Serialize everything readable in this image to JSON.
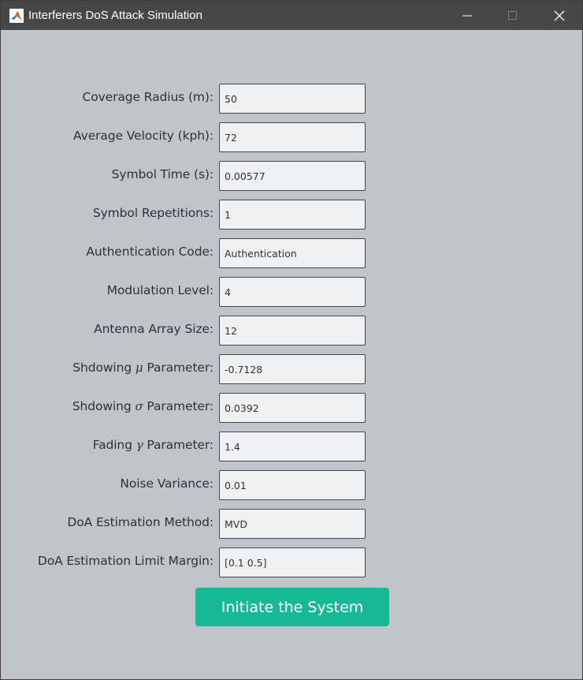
{
  "window": {
    "title": "Interferers DoS Attack Simulation",
    "app_icon": "matlab-icon"
  },
  "form": {
    "fields": [
      {
        "label": "Coverage Radius (m):",
        "value": "50"
      },
      {
        "label": "Average Velocity (kph):",
        "value": "72"
      },
      {
        "label": "Symbol Time (s):",
        "value": "0.00577"
      },
      {
        "label": "Symbol Repetitions:",
        "value": "1"
      },
      {
        "label": "Authentication Code:",
        "value": "Authentication"
      },
      {
        "label": "Modulation Level:",
        "value": "4"
      },
      {
        "label": "Antenna Array Size:",
        "value": "12"
      },
      {
        "label_pre": "Shdowing ",
        "label_symbol": "μ",
        "label_post": " Parameter:",
        "value": "-0.7128"
      },
      {
        "label_pre": "Shdowing ",
        "label_symbol": "σ",
        "label_post": " Parameter:",
        "value": "0.0392"
      },
      {
        "label_pre": "Fading ",
        "label_symbol": "γ",
        "label_post": " Parameter:",
        "value": "1.4"
      },
      {
        "label": "Noise Variance:",
        "value": "0.01"
      },
      {
        "label": "DoA Estimation Method:",
        "value": "MVD"
      },
      {
        "label": "DoA Estimation Limit Margin:",
        "value": "[0.1 0.5]"
      }
    ]
  },
  "actions": {
    "initiate_label": "Initiate the System"
  },
  "colors": {
    "background": "#c0c5c9",
    "titlebar": "#474747",
    "button": "#16b994",
    "field_bg": "#eef0f2",
    "field_border": "#3f4754"
  }
}
